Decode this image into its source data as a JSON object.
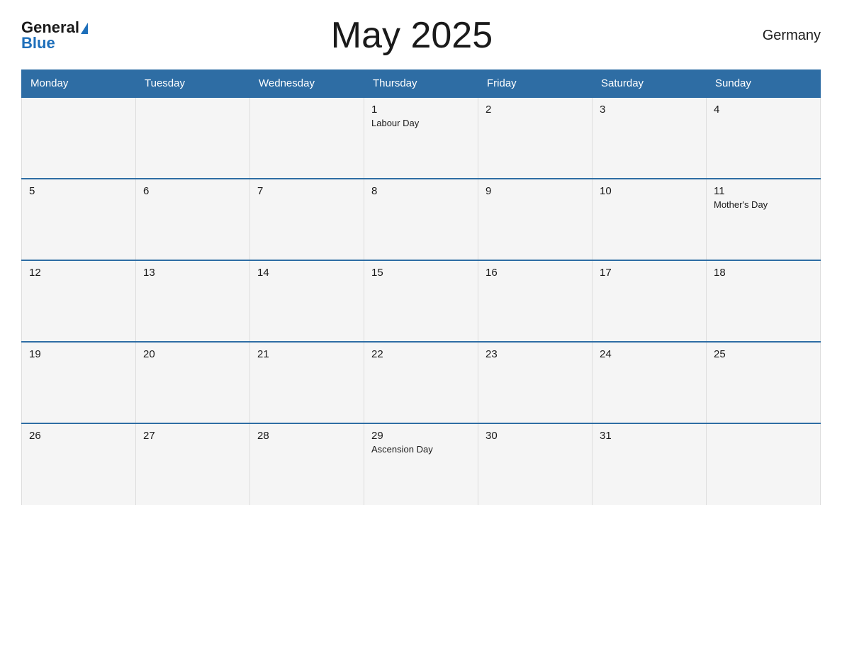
{
  "header": {
    "logo_general": "General",
    "logo_blue": "Blue",
    "title": "May 2025",
    "country": "Germany"
  },
  "calendar": {
    "weekdays": [
      "Monday",
      "Tuesday",
      "Wednesday",
      "Thursday",
      "Friday",
      "Saturday",
      "Sunday"
    ],
    "weeks": [
      [
        {
          "day": "",
          "holiday": ""
        },
        {
          "day": "",
          "holiday": ""
        },
        {
          "day": "",
          "holiday": ""
        },
        {
          "day": "1",
          "holiday": "Labour Day"
        },
        {
          "day": "2",
          "holiday": ""
        },
        {
          "day": "3",
          "holiday": ""
        },
        {
          "day": "4",
          "holiday": ""
        }
      ],
      [
        {
          "day": "5",
          "holiday": ""
        },
        {
          "day": "6",
          "holiday": ""
        },
        {
          "day": "7",
          "holiday": ""
        },
        {
          "day": "8",
          "holiday": ""
        },
        {
          "day": "9",
          "holiday": ""
        },
        {
          "day": "10",
          "holiday": ""
        },
        {
          "day": "11",
          "holiday": "Mother's Day"
        }
      ],
      [
        {
          "day": "12",
          "holiday": ""
        },
        {
          "day": "13",
          "holiday": ""
        },
        {
          "day": "14",
          "holiday": ""
        },
        {
          "day": "15",
          "holiday": ""
        },
        {
          "day": "16",
          "holiday": ""
        },
        {
          "day": "17",
          "holiday": ""
        },
        {
          "day": "18",
          "holiday": ""
        }
      ],
      [
        {
          "day": "19",
          "holiday": ""
        },
        {
          "day": "20",
          "holiday": ""
        },
        {
          "day": "21",
          "holiday": ""
        },
        {
          "day": "22",
          "holiday": ""
        },
        {
          "day": "23",
          "holiday": ""
        },
        {
          "day": "24",
          "holiday": ""
        },
        {
          "day": "25",
          "holiday": ""
        }
      ],
      [
        {
          "day": "26",
          "holiday": ""
        },
        {
          "day": "27",
          "holiday": ""
        },
        {
          "day": "28",
          "holiday": ""
        },
        {
          "day": "29",
          "holiday": "Ascension Day"
        },
        {
          "day": "30",
          "holiday": ""
        },
        {
          "day": "31",
          "holiday": ""
        },
        {
          "day": "",
          "holiday": ""
        }
      ]
    ]
  }
}
